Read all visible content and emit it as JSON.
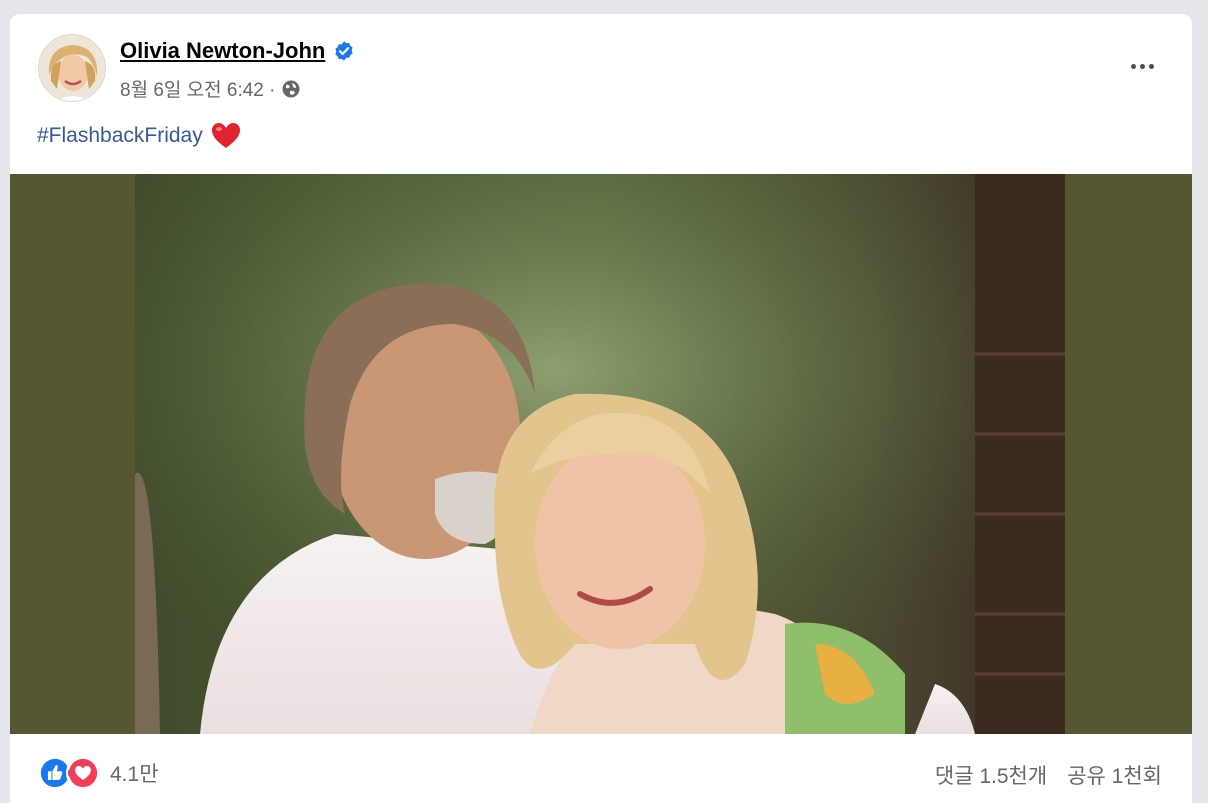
{
  "post": {
    "author": "Olivia Newton-John",
    "timestamp": "8월 6일 오전 6:42 ·",
    "caption_hashtag": "#FlashbackFriday",
    "caption_emoji": "heart-emoji"
  },
  "engagement": {
    "reaction_icons": [
      "like-icon",
      "love-icon"
    ],
    "reaction_count": "4.1만",
    "comments": "댓글 1.5천개",
    "shares": "공유 1천회"
  },
  "colors": {
    "link": "#385898",
    "verified": "#1877f2",
    "photo_letterbox": "#545730",
    "love": "#f33e58"
  }
}
